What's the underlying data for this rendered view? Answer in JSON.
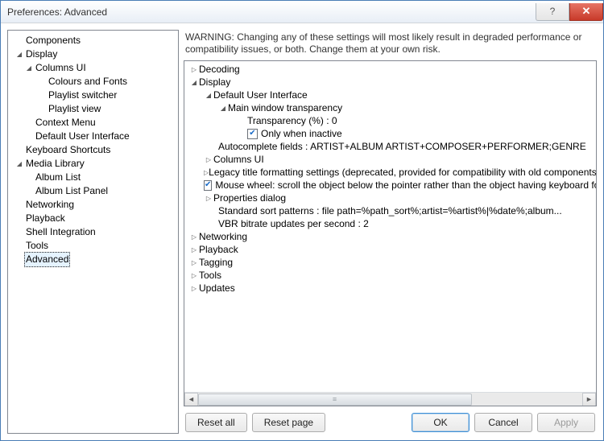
{
  "window": {
    "title": "Preferences: Advanced"
  },
  "sidebar": {
    "components": "Components",
    "display": "Display",
    "columns_ui": "Columns UI",
    "colours_fonts": "Colours and Fonts",
    "playlist_switcher": "Playlist switcher",
    "playlist_view": "Playlist view",
    "context_menu": "Context Menu",
    "default_ui": "Default User Interface",
    "keyboard_shortcuts": "Keyboard Shortcuts",
    "media_library": "Media Library",
    "album_list": "Album List",
    "album_list_panel": "Album List Panel",
    "networking": "Networking",
    "playback": "Playback",
    "shell_integration": "Shell Integration",
    "tools": "Tools",
    "advanced": "Advanced"
  },
  "warning": "WARNING: Changing any of these settings will most likely result in degraded performance or compatibility issues, or both. Change them at your own risk.",
  "tree": {
    "decoding": "Decoding",
    "display": "Display",
    "dui": "Default User Interface",
    "mwt": "Main window transparency",
    "transparency": "Transparency (%) : 0",
    "only_when_inactive": "Only when inactive",
    "autocomplete": "Autocomplete fields : ARTIST+ALBUM ARTIST+COMPOSER+PERFORMER;GENRE",
    "columns_ui": "Columns UI",
    "legacy": "Legacy title formatting settings (deprecated, provided for compatibility with old components or",
    "mouse_wheel": "Mouse wheel: scroll the object below the pointer rather than the object having keyboard fo",
    "properties_dialog": "Properties dialog",
    "sort_patterns": "Standard sort patterns : file path=%path_sort%;artist=%artist%|%date%;album...",
    "vbr": "VBR bitrate updates per second : 2",
    "networking": "Networking",
    "playback": "Playback",
    "tagging": "Tagging",
    "tools": "Tools",
    "updates": "Updates"
  },
  "buttons": {
    "reset_all": "Reset all",
    "reset_page": "Reset page",
    "ok": "OK",
    "cancel": "Cancel",
    "apply": "Apply"
  }
}
